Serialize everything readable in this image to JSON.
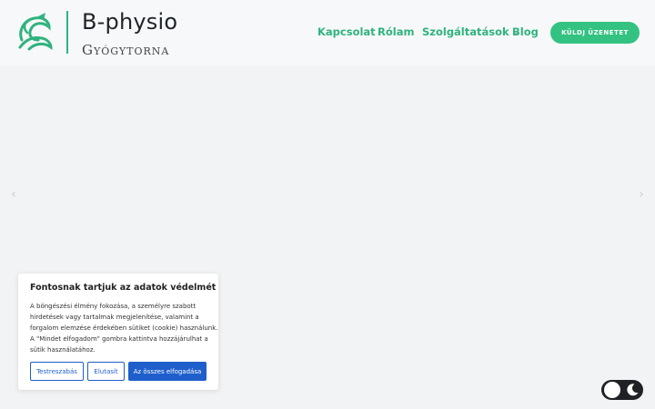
{
  "brand": {
    "name": "B-physio",
    "subtitle_first": "G",
    "subtitle_rest": "YÓGYTORNA",
    "logo_icon": "leaf-swirl-icon",
    "accent_color": "#2fb37f"
  },
  "nav": {
    "items": [
      {
        "label": "Kapcsolat"
      },
      {
        "label": "Rólam"
      },
      {
        "label": "Szolgáltatások",
        "has_dropdown": true
      },
      {
        "label": "Blog"
      }
    ],
    "cta_label": "KÜLDJ ÜZENETET",
    "cta_color": "#33c282"
  },
  "slider": {
    "prev_icon": "chevron-left-icon",
    "next_icon": "chevron-right-icon"
  },
  "cookie": {
    "title": "Fontosnak tartjuk az adatok védelmét",
    "lines": [
      "A böngészési élmény fokozása, a személyre szabott",
      "hirdetések vagy tartalmak megjelenítése, valamint a",
      "forgalom elemzése érdekében sütiket (cookie) használunk.",
      "A \"Mindet elfogadom\" gombra kattintva hozzájárulhat a",
      "sütik használatához."
    ],
    "buttons": {
      "customize": "Testreszabás",
      "reject": "Elutasít",
      "accept_all": "Az összes elfogadása"
    },
    "button_color": "#1f5fcc"
  },
  "theme_toggle": {
    "icon": "moon-icon",
    "background": "#1f2125"
  }
}
